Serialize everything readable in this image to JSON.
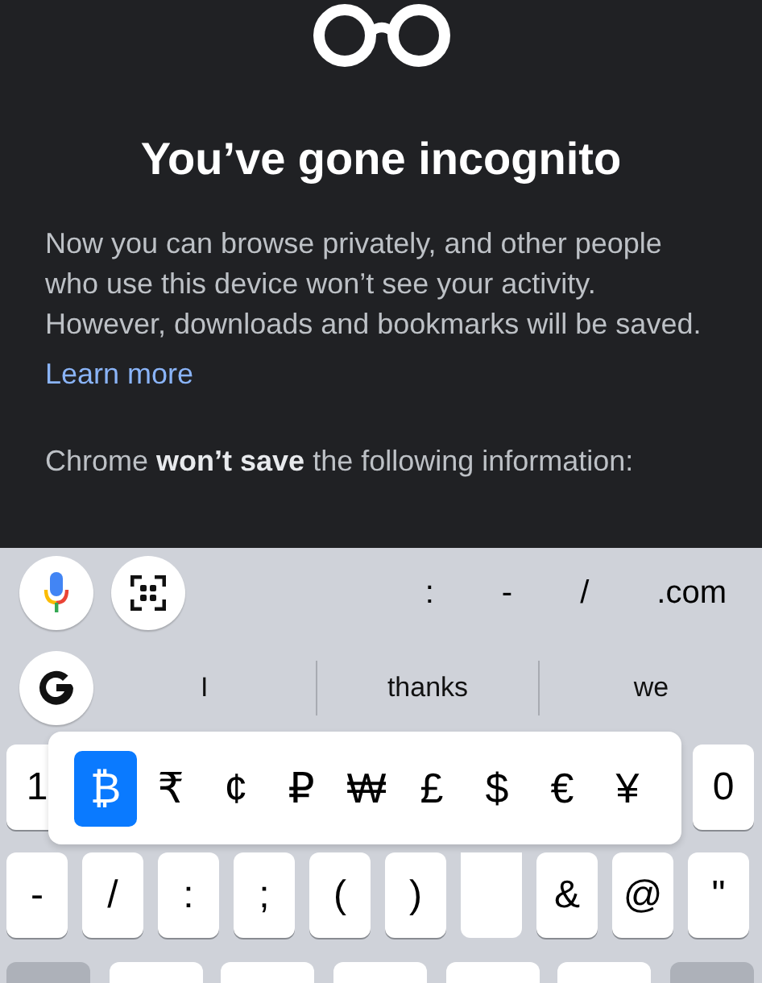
{
  "incognito": {
    "title": "You’ve gone incognito",
    "description": "Now you can browse privately, and other people who use this device won’t see your activity. However, downloads and bookmarks will be saved.",
    "link": "Learn more",
    "note": "Chrome **won’t save** the following information:"
  },
  "toolbar": {
    "shortcuts": [
      ":",
      "-",
      "/",
      ".com"
    ]
  },
  "suggestions": [
    "I",
    "thanks",
    "we"
  ],
  "number_row": {
    "left_key": "1",
    "right_key": "0"
  },
  "currency_popup": [
    {
      "label": "₿",
      "selected": true
    },
    {
      "label": "₹",
      "selected": false
    },
    {
      "label": "¢",
      "selected": false
    },
    {
      "label": "₽",
      "selected": false
    },
    {
      "label": "₩",
      "selected": false
    },
    {
      "label": "£",
      "selected": false
    },
    {
      "label": "$",
      "selected": false
    },
    {
      "label": "€",
      "selected": false
    },
    {
      "label": "¥",
      "selected": false
    }
  ],
  "symbol_row": [
    {
      "kind": "key",
      "label": "-"
    },
    {
      "kind": "key",
      "label": "/"
    },
    {
      "kind": "key",
      "label": ":"
    },
    {
      "kind": "key",
      "label": ";"
    },
    {
      "kind": "key",
      "label": "("
    },
    {
      "kind": "key",
      "label": ")"
    },
    {
      "kind": "popup-stem"
    },
    {
      "kind": "key",
      "label": "&"
    },
    {
      "kind": "key",
      "label": "@"
    },
    {
      "kind": "key",
      "label": "\""
    }
  ],
  "bottom_row": [
    {
      "kind": "function"
    },
    {
      "kind": "key"
    },
    {
      "kind": "key"
    },
    {
      "kind": "key"
    },
    {
      "kind": "key"
    },
    {
      "kind": "key"
    },
    {
      "kind": "function"
    }
  ]
}
